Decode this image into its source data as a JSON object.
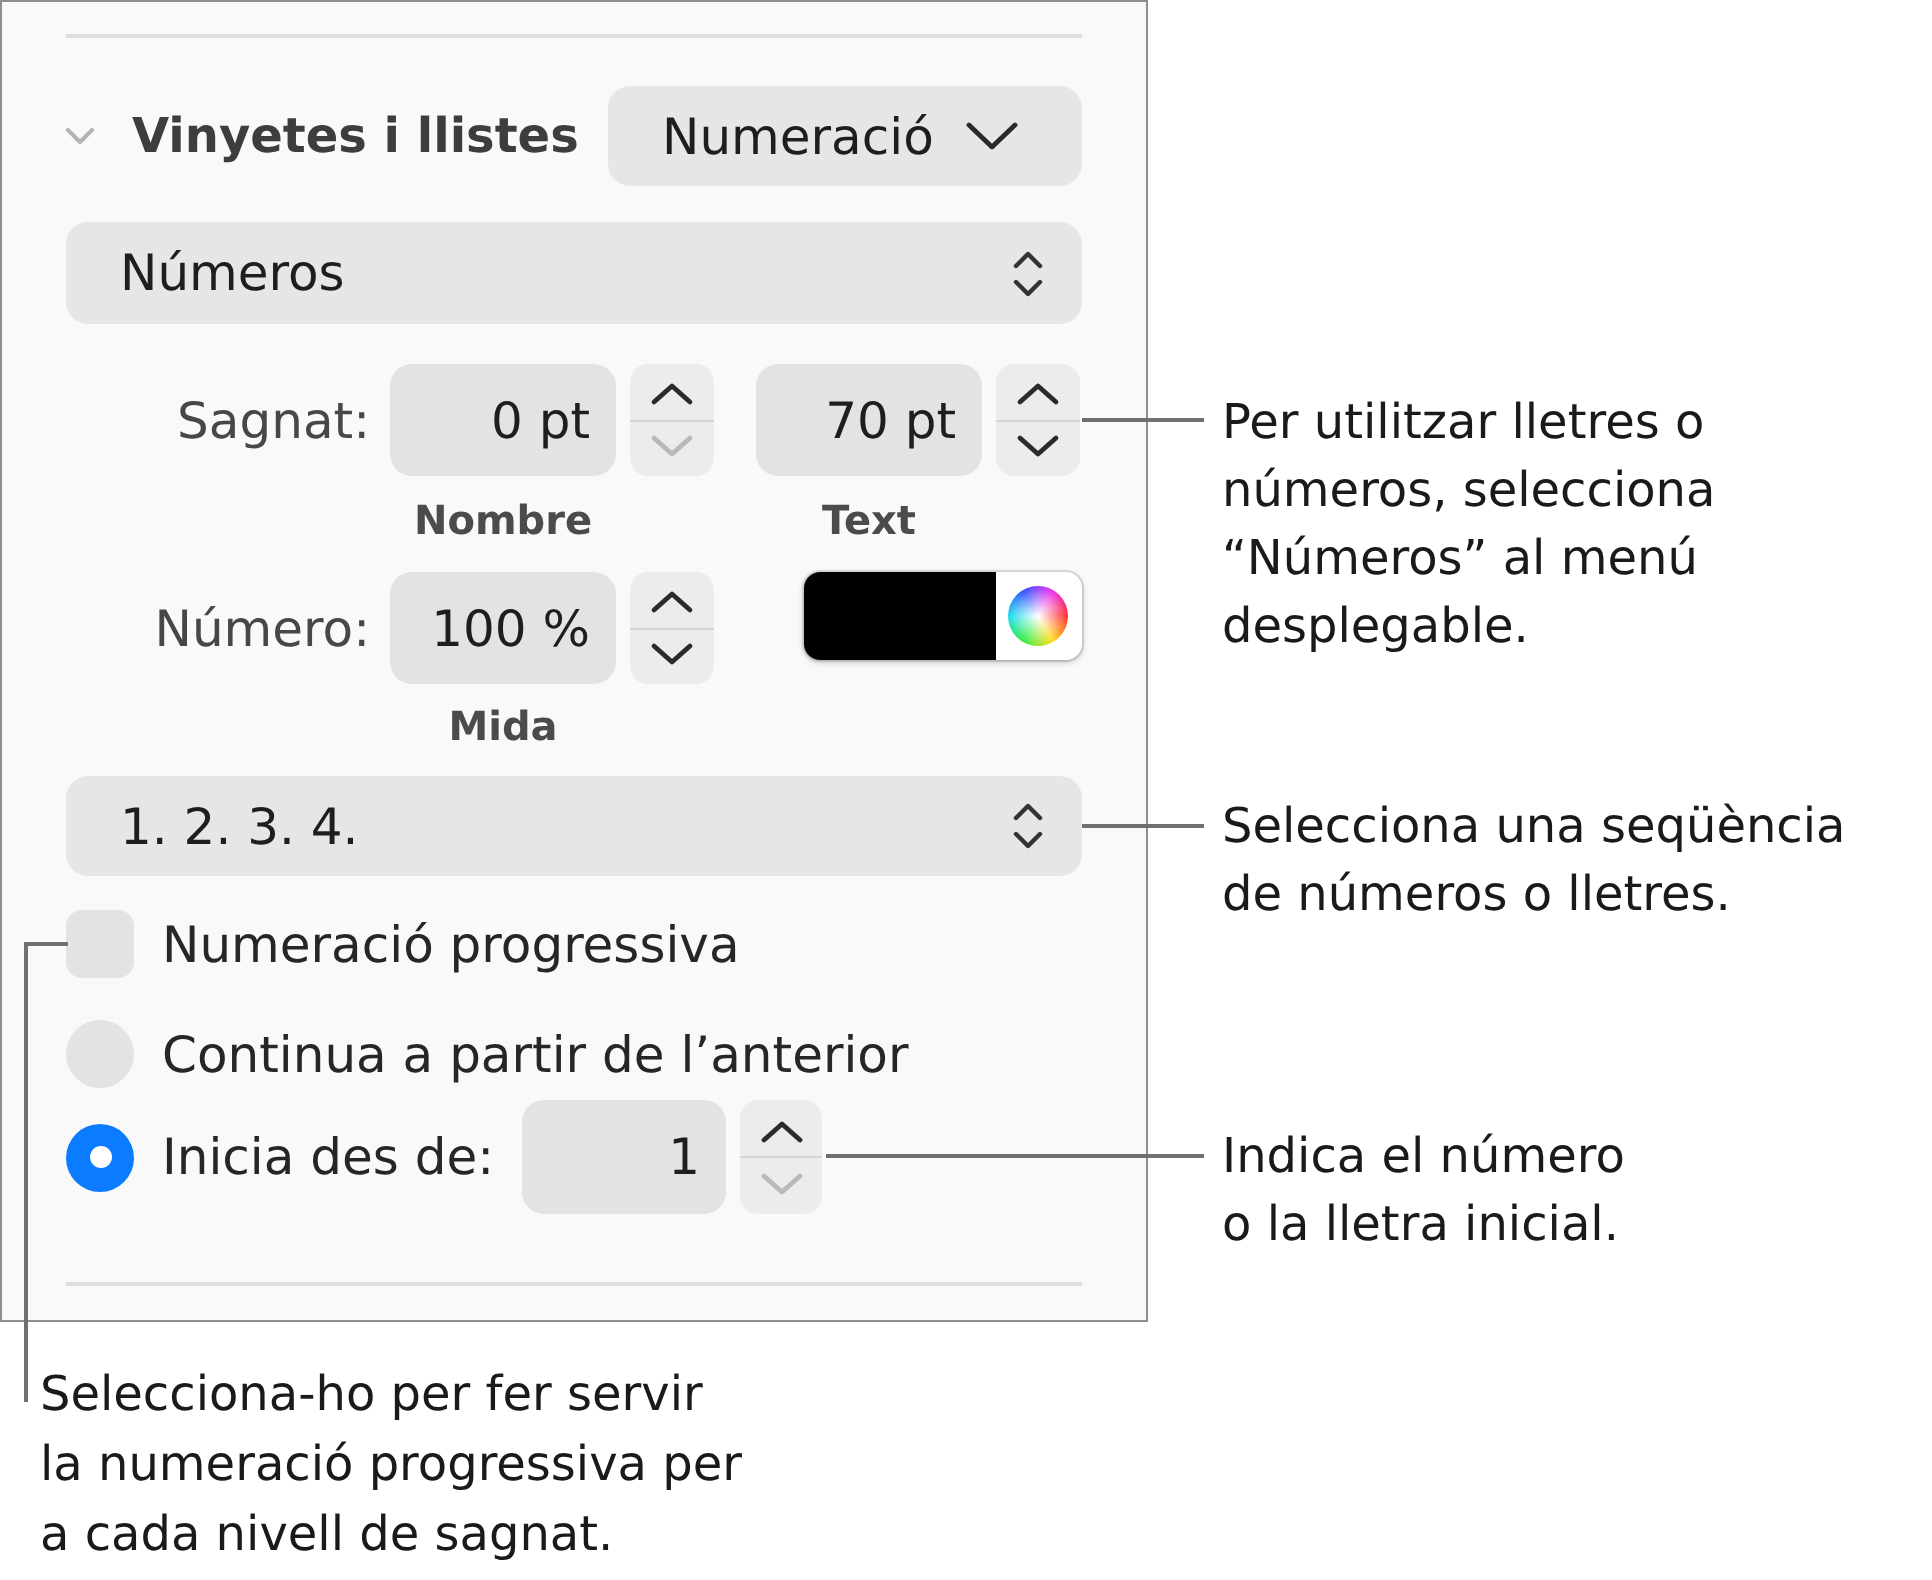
{
  "section": {
    "title": "Vinyetes i llistes",
    "expanded": true,
    "style_menu": "Numeració"
  },
  "format_popup": "Números",
  "indent": {
    "label": "Sagnat:",
    "fields": [
      {
        "value": "0 pt",
        "caption": "Nombre",
        "can_increase": true,
        "can_decrease": false
      },
      {
        "value": "70 pt",
        "caption": "Text",
        "can_increase": true,
        "can_decrease": true
      }
    ]
  },
  "number_size": {
    "label": "Número:",
    "value": "100 %",
    "caption": "Mida",
    "can_increase": true,
    "can_decrease": true
  },
  "number_color": {
    "color": "#000000"
  },
  "sequence_popup": "1. 2. 3. 4.",
  "tiered_numbers": {
    "label": "Numeració progressiva",
    "checked": false
  },
  "start_options": [
    {
      "kind": "continue",
      "label": "Continua a partir de l’anterior",
      "selected": false
    },
    {
      "kind": "start_at",
      "label": "Inicia des de:",
      "selected": true,
      "value": "1",
      "can_increase": true,
      "can_decrease": false
    }
  ],
  "callouts": [
    {
      "text": "Per utilitzar lletres o\nnúmeros, selecciona\n“Números” al menú\ndesplegable."
    },
    {
      "text": "Selecciona una seqüència\nde números o lletres."
    },
    {
      "text": "Indica el número\no la lletra inicial."
    },
    {
      "text": "Selecciona-ho per fer servir\nla numeració progressiva per\na cada nivell de sagnat."
    }
  ]
}
